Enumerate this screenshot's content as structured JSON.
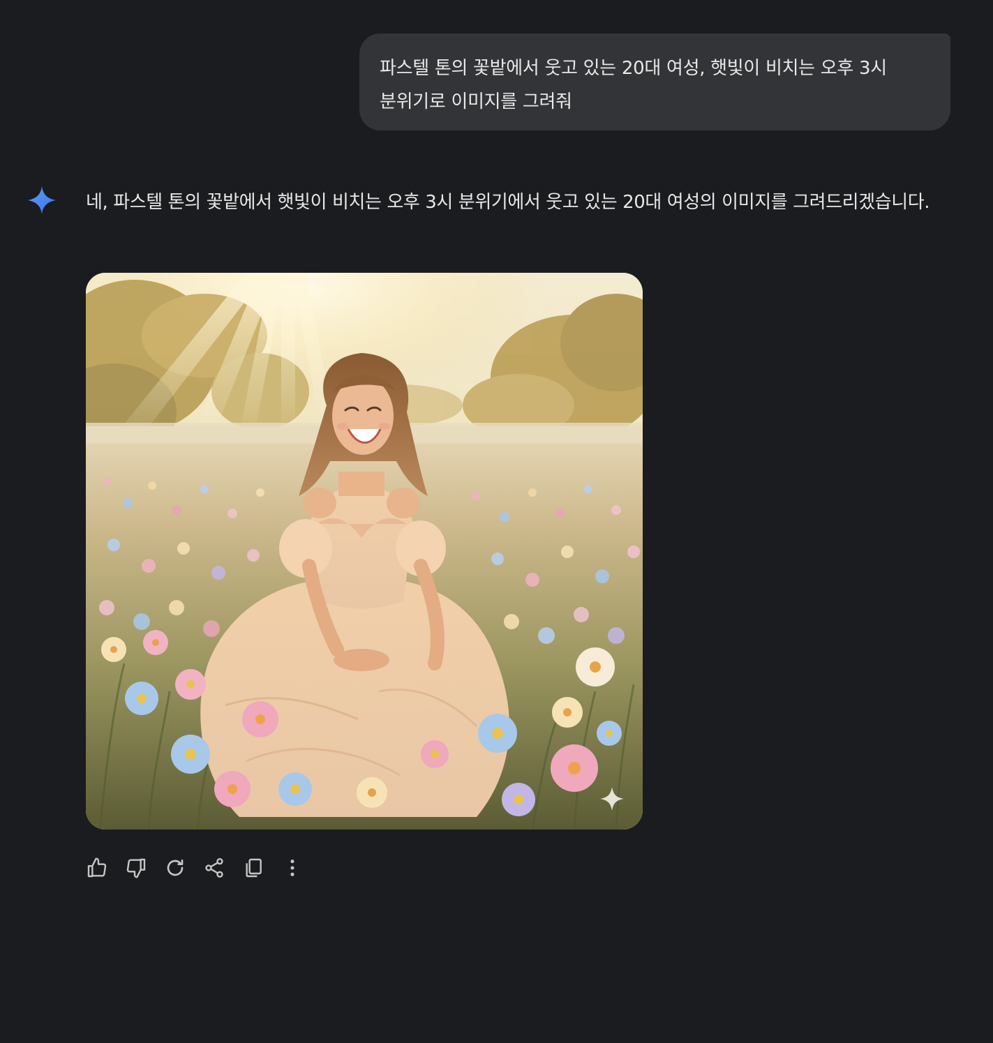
{
  "user_message": {
    "text": "파스텔 톤의 꽃밭에서 웃고 있는 20대 여성, 햇빛이 비치는 오후 3시 분위기로 이미지를 그려줘"
  },
  "assistant_message": {
    "avatar_icon": "gemini-spark-icon",
    "text": "네, 파스텔 톤의 꽃밭에서 햇빛이 비치는 오후 3시 분위기에서 웃고 있는 20대 여성의 이미지를 그려드리겠습니다.",
    "image": {
      "subject": "woman in a cream off-shoulder dress laughing in a pastel flower field under afternoon sunlight",
      "watermark_icon": "sparkle-watermark-icon"
    }
  },
  "actions": [
    {
      "icon": "thumbs-up-icon",
      "name": "good-response-button"
    },
    {
      "icon": "thumbs-down-icon",
      "name": "bad-response-button"
    },
    {
      "icon": "refresh-icon",
      "name": "regenerate-button"
    },
    {
      "icon": "share-icon",
      "name": "share-button"
    },
    {
      "icon": "copy-icon",
      "name": "copy-button"
    },
    {
      "icon": "more-vert-icon",
      "name": "more-options-button"
    }
  ],
  "colors": {
    "background": "#1b1c1f",
    "user_bubble": "#333437",
    "text": "#e8e8e8",
    "icon": "#c4c7c5",
    "spark_blue": "#4a8bf5"
  }
}
